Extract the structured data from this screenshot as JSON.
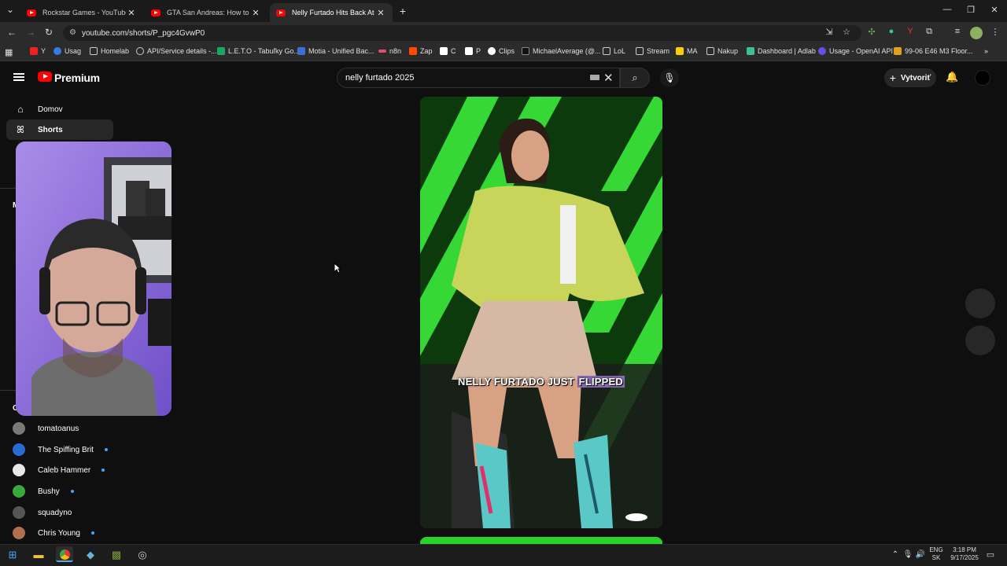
{
  "browser": {
    "tabs": [
      {
        "title": "Rockstar Games - YouTube",
        "active": false
      },
      {
        "title": "GTA San Andreas: How to Get a",
        "active": false
      },
      {
        "title": "Nelly Furtado Hits Back At Fat S",
        "active": true
      }
    ],
    "url": "youtube.com/shorts/P_pgc4GvwP0",
    "bookmarks": [
      "Y",
      "Usag",
      "Homelab",
      "API/Service details -...",
      "L.E.T.O - Tabuľky Go...",
      "Motia - Unified Bac...",
      "n8n",
      "Zap",
      "C",
      "P",
      "Clips",
      "MichaelAverage (@...",
      "LoL",
      "Stream",
      "MA",
      "Nakup",
      "Dashboard | Adlab",
      "Usage - OpenAI API",
      "99-06 E46 M3 Floor..."
    ]
  },
  "youtube": {
    "brand": "Premium",
    "search_value": "nelly furtado 2025",
    "create_label": "Vytvoriť",
    "sidebar": {
      "items": [
        {
          "label": "Domov",
          "icon": "home-icon"
        },
        {
          "label": "Shorts",
          "icon": "shorts-icon",
          "selected": true
        }
      ],
      "section_partial_1": "M",
      "section_partial_2": "Ou",
      "subscriptions": [
        {
          "name": "tomatoanus",
          "new": false,
          "color": "#7a7a7a"
        },
        {
          "name": "The Spiffing Brit",
          "new": true,
          "color": "#2a6bd1"
        },
        {
          "name": "Caleb Hammer",
          "new": true,
          "color": "#e8e8e8"
        },
        {
          "name": "Bushy",
          "new": true,
          "color": "#3aa83a"
        },
        {
          "name": "squadyno",
          "new": false,
          "color": "#555555"
        },
        {
          "name": "Chris Young",
          "new": true,
          "color": "#b07050"
        }
      ]
    },
    "short": {
      "caption_part1": "NELLY FURTADO JUST ",
      "caption_highlight": "FLIPPED"
    }
  },
  "taskbar": {
    "lang1": "ENG",
    "lang2": "SK",
    "time": "3:18 PM",
    "date": "9/17/2025"
  }
}
